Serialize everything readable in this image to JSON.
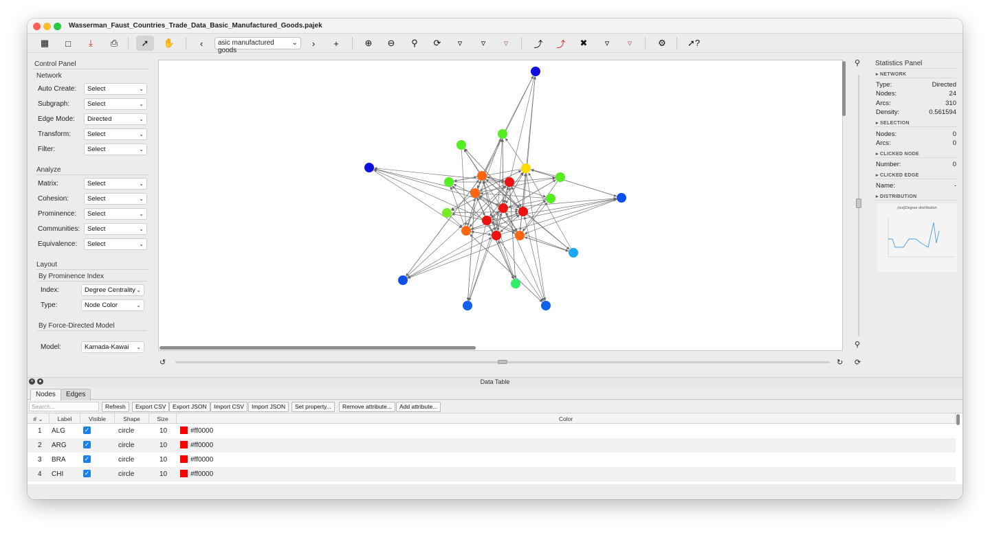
{
  "window": {
    "title": "Wasserman_Faust_Countries_Trade_Data_Basic_Manufactured_Goods.pajek",
    "traffic_lights": [
      "#ff5f57",
      "#febc2e",
      "#28c840"
    ]
  },
  "toolbar": {
    "icons": [
      "open-file-icon",
      "folder-icon",
      "download-icon",
      "print-icon",
      "select-pointer-icon",
      "pan-hand-icon",
      "chevron-left-icon",
      "chevron-right-icon",
      "plus-icon",
      "zoom-in-icon",
      "zoom-out-icon",
      "search-icon",
      "rotate-icon",
      "filter-icon",
      "filter-nodes-icon",
      "filter-edges-icon",
      "edge-icon",
      "edge-red-icon",
      "tools-icon",
      "filter-off-icon",
      "filter-disabled-icon",
      "settings-icon",
      "help-icon"
    ],
    "relation_select": "asic manufactured goods"
  },
  "control_panel": {
    "title": "Control Panel",
    "network_header": "Network",
    "network_rows": [
      {
        "label": "Auto Create:",
        "value": "Select"
      },
      {
        "label": "Subgraph:",
        "value": "Select"
      },
      {
        "label": "Edge Mode:",
        "value": "Directed"
      },
      {
        "label": "Transform:",
        "value": "Select"
      },
      {
        "label": "Filter:",
        "value": "Select"
      }
    ],
    "analyze_header": "Analyze",
    "analyze_rows": [
      {
        "label": "Matrix:",
        "value": "Select"
      },
      {
        "label": "Cohesion:",
        "value": "Select"
      },
      {
        "label": "Prominence:",
        "value": "Select"
      },
      {
        "label": "Communities:",
        "value": "Select"
      },
      {
        "label": "Equivalence:",
        "value": "Select"
      }
    ],
    "layout_header": "Layout",
    "by_prominence": "By Prominence Index",
    "index_label": "Index:",
    "index_value": "Degree Centrality",
    "type_label": "Type:",
    "type_value": "Node Color",
    "by_force": "By Force-Directed Model",
    "model_label": "Model:",
    "model_value": "Kamada-Kawai"
  },
  "statistics": {
    "title": "Statistics Panel",
    "network_header": "▸ NETWORK",
    "type_label": "Type:",
    "type_value": "Directed",
    "nodes_label": "Nodes:",
    "nodes_value": "24",
    "arcs_label": "Arcs:",
    "arcs_value": "310",
    "density_label": "Density:",
    "density_value": "0.561594",
    "selection_header": "▸ SELECTION",
    "sel_nodes_label": "Nodes:",
    "sel_nodes_value": "0",
    "sel_arcs_label": "Arcs:",
    "sel_arcs_value": "0",
    "clicked_node_header": "▸ CLICKED NODE",
    "number_label": "Number:",
    "number_value": "0",
    "clicked_edge_header": "▸ CLICKED EDGE",
    "name_label": "Name:",
    "name_value": "-",
    "distribution_header": "▸ DISTRIBUTION",
    "chart_title": "(out)Degree distribution"
  },
  "network_graph": {
    "nodes": [
      {
        "id": "n01",
        "color": "#1010dd"
      },
      {
        "id": "n02",
        "color": "#1010dd"
      },
      {
        "id": "n03",
        "color": "#1050ee"
      },
      {
        "id": "n04",
        "color": "#1050ee"
      },
      {
        "id": "n05",
        "color": "#1060ee"
      },
      {
        "id": "n06",
        "color": "#1060ee"
      },
      {
        "id": "n07",
        "color": "#1aa8f0"
      },
      {
        "id": "n08",
        "color": "#33ee66"
      },
      {
        "id": "n09",
        "color": "#55ee22"
      },
      {
        "id": "n10",
        "color": "#55ee22"
      },
      {
        "id": "n11",
        "color": "#55ee22"
      },
      {
        "id": "n12",
        "color": "#55ee22"
      },
      {
        "id": "n13",
        "color": "#55ee22"
      },
      {
        "id": "n14",
        "color": "#77ee22"
      },
      {
        "id": "n15",
        "color": "#ffdd00"
      },
      {
        "id": "n16",
        "color": "#ff6611"
      },
      {
        "id": "n17",
        "color": "#ff6611"
      },
      {
        "id": "n18",
        "color": "#ff6611"
      },
      {
        "id": "n19",
        "color": "#ff6611"
      },
      {
        "id": "n20",
        "color": "#ee1111"
      },
      {
        "id": "n21",
        "color": "#ee1111"
      },
      {
        "id": "n22",
        "color": "#ee1111"
      },
      {
        "id": "n23",
        "color": "#ee1111"
      },
      {
        "id": "n24",
        "color": "#ee1111"
      }
    ]
  },
  "data_table": {
    "title": "Data Table",
    "tabs": [
      "Nodes",
      "Edges"
    ],
    "search_placeholder": "Search...",
    "buttons": [
      "Refresh",
      "Export CSV",
      "Export JSON",
      "Import CSV",
      "Import JSON",
      "Set property...",
      "Remove attribute...",
      "Add attribute..."
    ],
    "columns": [
      "#",
      "Label",
      "Visible",
      "Shape",
      "Size",
      "Color"
    ],
    "rows": [
      {
        "num": "1",
        "label": "ALG",
        "shape": "circle",
        "size": "10",
        "color": "#ff0000"
      },
      {
        "num": "2",
        "label": "ARG",
        "shape": "circle",
        "size": "10",
        "color": "#ff0000"
      },
      {
        "num": "3",
        "label": "BRA",
        "shape": "circle",
        "size": "10",
        "color": "#ff0000"
      },
      {
        "num": "4",
        "label": "CHI",
        "shape": "circle",
        "size": "10",
        "color": "#ff0000"
      }
    ]
  }
}
